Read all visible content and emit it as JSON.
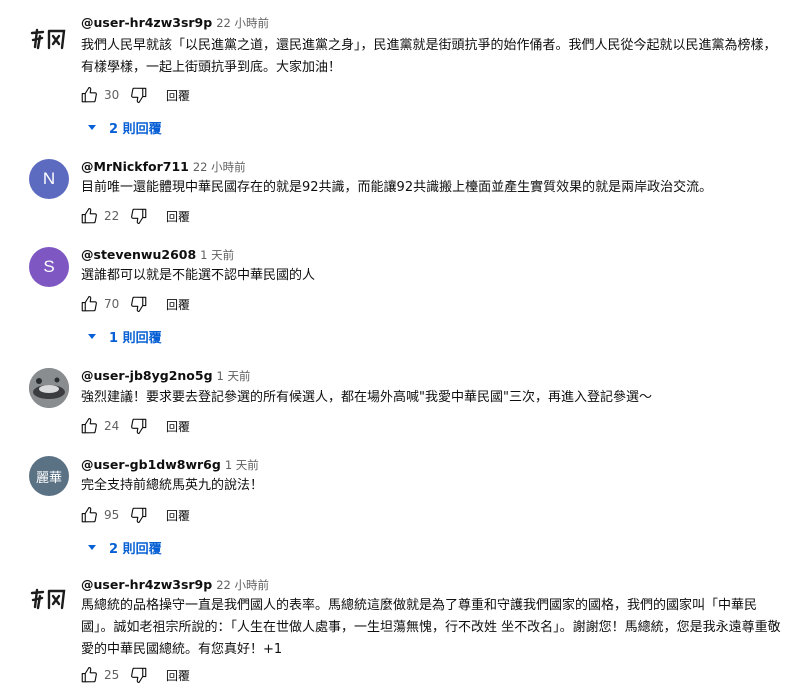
{
  "comments": [
    {
      "handle": "@user-hr4zw3sr9p",
      "time": "22 小時前",
      "text": "我們人民早就該「以民進黨之道，還民進黨之身」，民進黨就是街頭抗爭的始作俑者。我們人民從今起就以民進黨為榜樣，有樣學樣，一起上街頭抗爭到底。大家加油！",
      "likes": "30",
      "reply_label": "回覆",
      "replies_label": "2 則回覆",
      "avatar": {
        "type": "logo",
        "color": "#1c1c1c",
        "label": "calligraphy-logo"
      }
    },
    {
      "handle": "@MrNickfor711",
      "time": "22 小時前",
      "text": "目前唯一還能體現中華民國存在的就是92共識，而能讓92共識搬上檯面並產生實質效果的就是兩岸政治交流。",
      "likes": "22",
      "reply_label": "回覆",
      "avatar": {
        "type": "letter",
        "letter": "N",
        "color": "#5c6bc0"
      }
    },
    {
      "handle": "@stevenwu2608",
      "time": "1 天前",
      "text": "選誰都可以就是不能選不認中華民國的人",
      "likes": "70",
      "reply_label": "回覆",
      "replies_label": "1 則回覆",
      "avatar": {
        "type": "letter",
        "letter": "S",
        "color": "#7e57c2"
      }
    },
    {
      "handle": "@user-jb8yg2no5g",
      "time": "1 天前",
      "text": "強烈建議！要求要去登記參選的所有候選人，都在場外高喊\"我愛中華民國\"三次，再進入登記參選～",
      "likes": "24",
      "reply_label": "回覆",
      "avatar": {
        "type": "photo",
        "color": "#6b6e72"
      }
    },
    {
      "handle": "@user-gb1dw8wr6g",
      "time": "1 天前",
      "text": "完全支持前總統馬英九的說法！",
      "likes": "95",
      "reply_label": "回覆",
      "replies_label": "2 則回覆",
      "avatar": {
        "type": "letter",
        "letter": "麗華",
        "color": "#5b7285"
      }
    },
    {
      "handle": "@user-hr4zw3sr9p",
      "time": "22 小時前",
      "text": "馬總統的品格操守一直是我們國人的表率。馬總統這麼做就是為了尊重和守護我們國家的國格，我們的國家叫「中華民國」。誠如老祖宗所說的：「人生在世做人處事，一生坦蕩無愧，行不改姓 坐不改名」。謝謝您！馬總統，您是我永遠尊重敬愛的中華民國總統。有您真好！+1",
      "likes": "25",
      "reply_label": "回覆",
      "avatar": {
        "type": "logo",
        "color": "#1c1c1c",
        "label": "calligraphy-logo"
      }
    }
  ]
}
